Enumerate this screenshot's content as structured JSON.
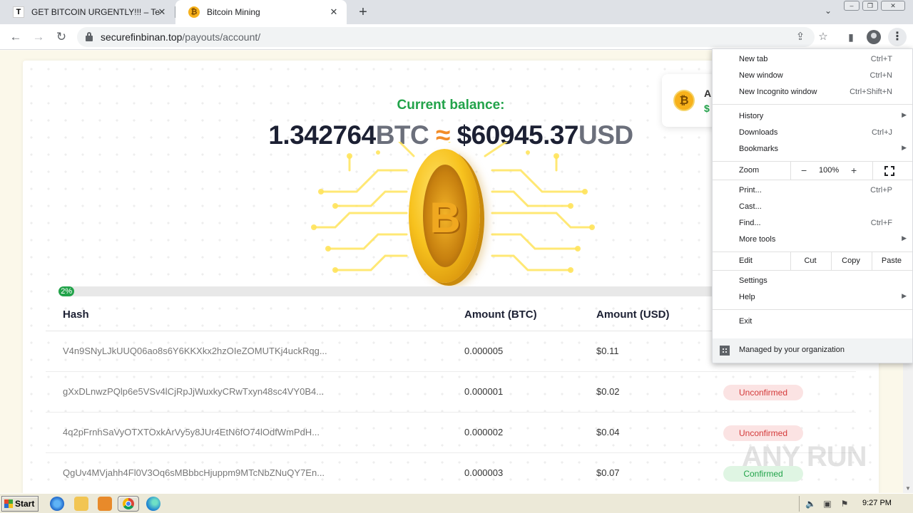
{
  "browser": {
    "tabs": [
      {
        "title": "GET BITCOIN URGENTLY!!! – Telegra",
        "favicon": "T"
      },
      {
        "title": "Bitcoin Mining",
        "favicon": "₿"
      }
    ],
    "url_domain": "securefinbinan.top",
    "url_path": "/payouts/account/"
  },
  "page": {
    "balance_label": "Current balance:",
    "btc_amount": "1.342764",
    "btc_unit": "BTC",
    "approx": "≈",
    "usd_amount": "$60945.37",
    "usd_unit": "USD",
    "progress_label": "2%",
    "progress_fraction": 0.02,
    "side_card": {
      "line1": "A",
      "line2": "$",
      "icon": "₿"
    },
    "table": {
      "headers": [
        "Hash",
        "Amount (BTC)",
        "Amount (USD)"
      ],
      "rows": [
        {
          "hash": "V4n9SNyLJkUUQ06ao8s6Y6KKXkx2hzOIeZOMUTKj4uckRqg...",
          "btc": "0.000005",
          "usd": "$0.11",
          "status": ""
        },
        {
          "hash": "gXxDLnwzPQlp6e5VSv4lCjRpJjWuxkyCRwTxyn48sc4VY0B4...",
          "btc": "0.000001",
          "usd": "$0.02",
          "status": "Unconfirmed"
        },
        {
          "hash": "4q2pFrnhSaVyOTXTOxkArVy5y8JUr4EtN6fO74lOdfWmPdH...",
          "btc": "0.000002",
          "usd": "$0.04",
          "status": "Unconfirmed"
        },
        {
          "hash": "QgUv4MVjahh4Fl0V3Oq6sMBbbcHjuppm9MTcNbZNuQY7En...",
          "btc": "0.000003",
          "usd": "$0.07",
          "status": "Confirmed"
        }
      ]
    },
    "watermark": "ANY RUN"
  },
  "menu": {
    "new_tab": "New tab",
    "new_tab_sc": "Ctrl+T",
    "new_window": "New window",
    "new_window_sc": "Ctrl+N",
    "incognito": "New Incognito window",
    "incognito_sc": "Ctrl+Shift+N",
    "history": "History",
    "downloads": "Downloads",
    "downloads_sc": "Ctrl+J",
    "bookmarks": "Bookmarks",
    "zoom": "Zoom",
    "zoom_minus": "−",
    "zoom_value": "100%",
    "zoom_plus": "+",
    "print": "Print...",
    "print_sc": "Ctrl+P",
    "cast": "Cast...",
    "find": "Find...",
    "find_sc": "Ctrl+F",
    "more_tools": "More tools",
    "edit": "Edit",
    "cut": "Cut",
    "copy": "Copy",
    "paste": "Paste",
    "settings": "Settings",
    "help": "Help",
    "exit": "Exit",
    "managed": "Managed by your organization"
  },
  "taskbar": {
    "start": "Start",
    "clock": "9:27 PM"
  },
  "colors": {
    "accent_green": "#22a34a",
    "accent_orange": "#f28c28",
    "coin_gold": "#f7c21e"
  }
}
